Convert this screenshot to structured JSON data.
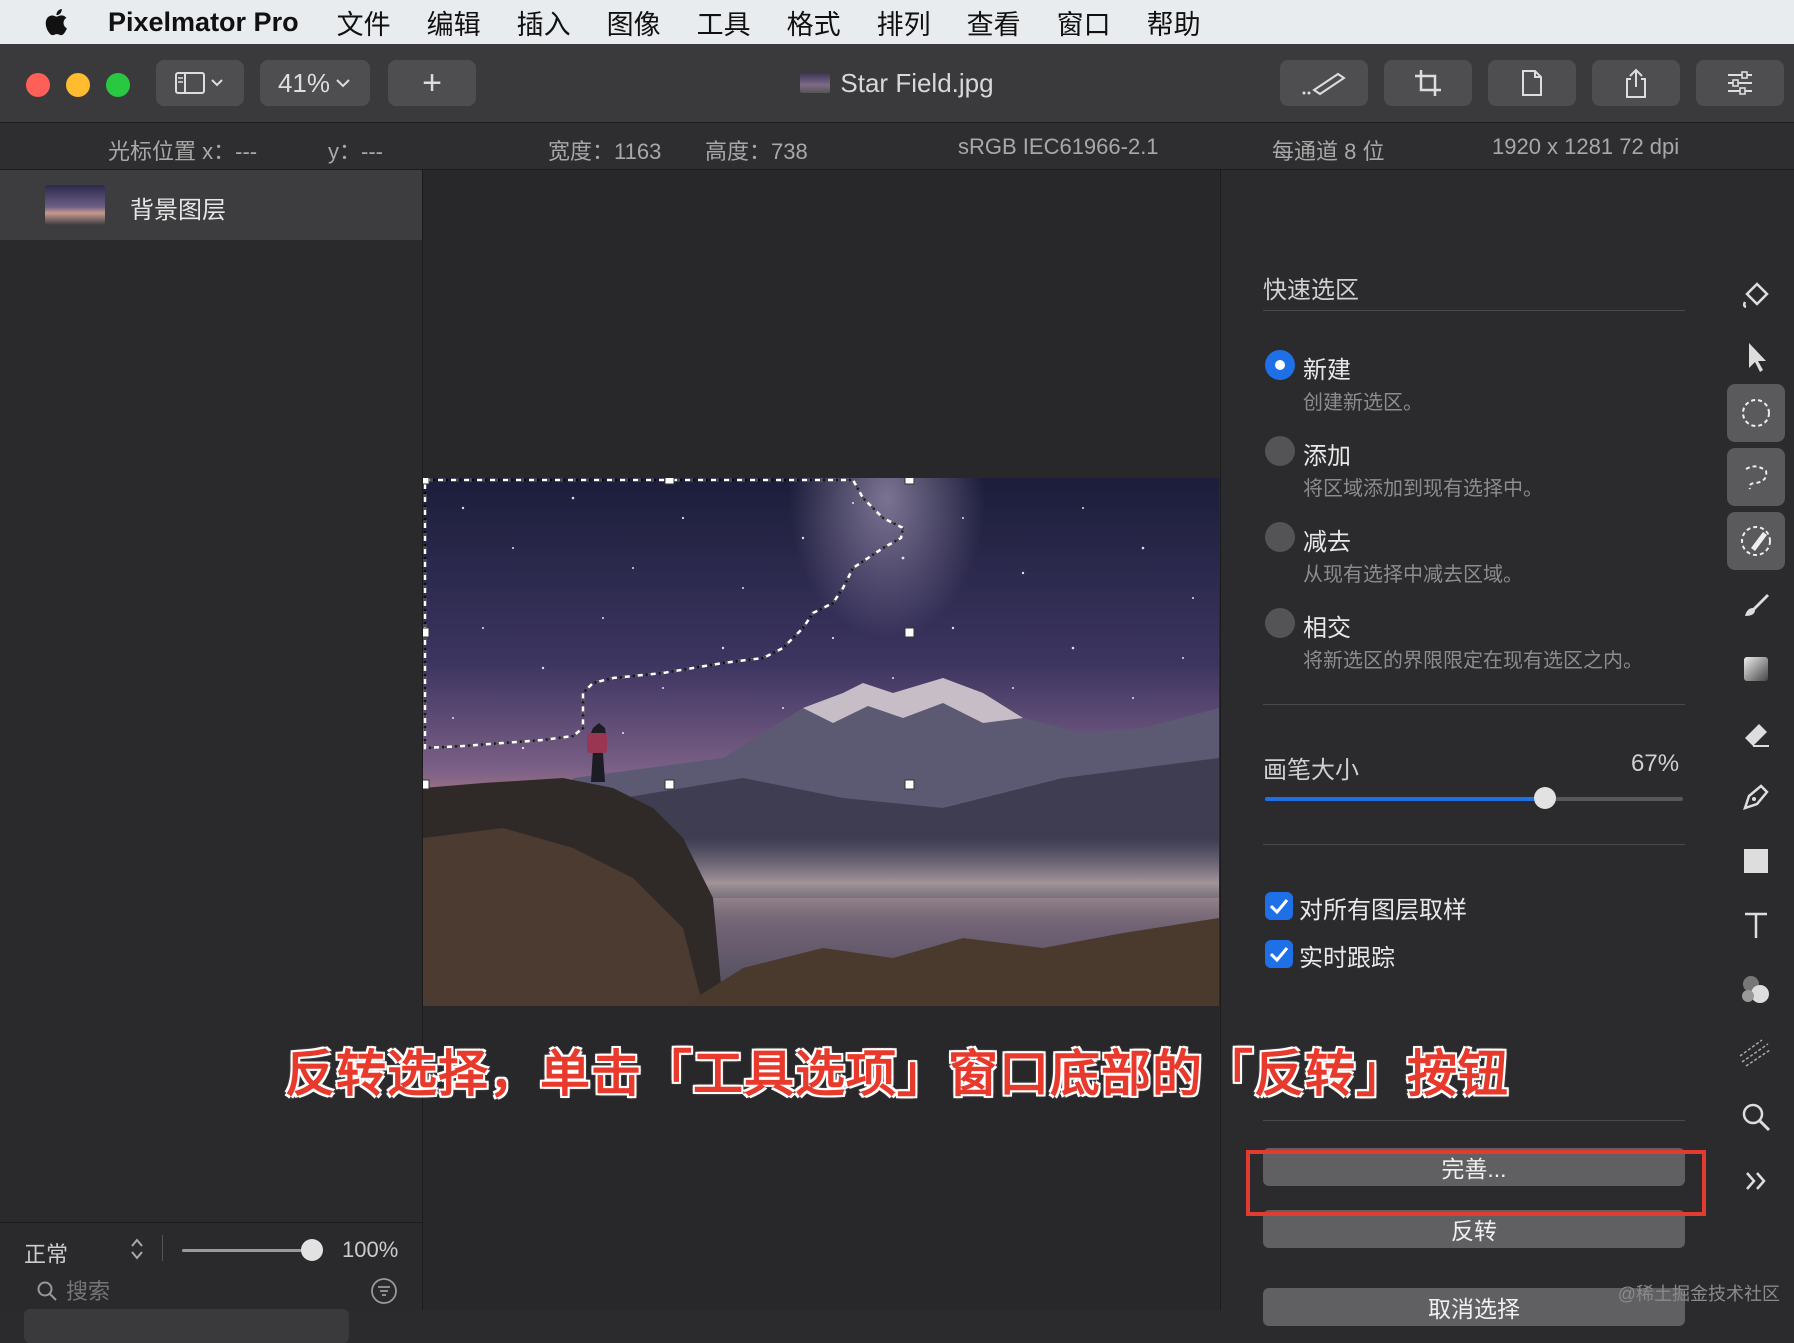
{
  "menubar": {
    "app_name": "Pixelmator Pro",
    "items": [
      "文件",
      "编辑",
      "插入",
      "图像",
      "工具",
      "格式",
      "排列",
      "查看",
      "窗口",
      "帮助"
    ]
  },
  "toolbar": {
    "zoom": "41%",
    "add_label": "+",
    "doc_title": "Star Field.jpg"
  },
  "infobar": {
    "cursor_x": "光标位置 x：---",
    "cursor_y": "y：---",
    "width": "宽度：1163",
    "height": "高度：738",
    "color_profile": "sRGB IEC61966-2.1",
    "bit_depth": "每通道 8 位",
    "image_size": "1920 x 1281 72 dpi"
  },
  "layers": {
    "items": [
      {
        "name": "背景图层"
      }
    ],
    "blend_mode": "正常",
    "opacity": "100%",
    "opacity_fraction": 1.0,
    "search_placeholder": "搜索"
  },
  "tool_options": {
    "title": "快速选区",
    "modes": [
      {
        "label": "新建",
        "desc": "创建新选区。",
        "selected": true
      },
      {
        "label": "添加",
        "desc": "将区域添加到现有选择中。",
        "selected": false
      },
      {
        "label": "减去",
        "desc": "从现有选择中减去区域。",
        "selected": false
      },
      {
        "label": "相交",
        "desc": "将新选区的界限限定在现有选区之内。",
        "selected": false
      }
    ],
    "brush_size_label": "画笔大小",
    "brush_size_value": "67%",
    "brush_size_fraction": 0.67,
    "sample_all_layers": "对所有图层取样",
    "live_tracing": "实时跟踪",
    "refine_button": "完善...",
    "invert_button": "反转",
    "deselect_button": "取消选择"
  },
  "tools": [
    "paint-bucket-icon",
    "arrange-pointer-icon",
    "selection-marquee-icon",
    "lasso-icon",
    "quick-selection-icon",
    "paint-brush-icon",
    "gradient-icon",
    "eraser-icon",
    "pen-icon",
    "shape-icon",
    "type-icon",
    "retouch-icon",
    "distort-icon",
    "zoom-icon",
    "more-tools-icon"
  ],
  "annotation": {
    "caption": "反转选择，单击「工具选项」窗口底部的「反转」按钮"
  },
  "watermark": "@稀土掘金技术社区",
  "colors": {
    "accent_blue": "#1f6fe6",
    "highlight_red": "#e23c30",
    "caption_red": "#e83a2c"
  }
}
